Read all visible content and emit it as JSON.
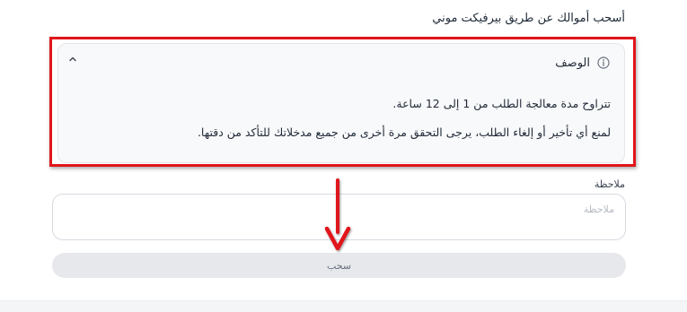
{
  "heading": "أسحب أموالك عن طريق بيرفيكت موني",
  "description_card": {
    "title": "الوصف",
    "line1": "تتراوح مدة معالجة الطلب من 1 إلى 12 ساعة.",
    "line2": "لمنع أي تأخير أو إلغاء الطلب، يرجى التحقق مرة أخرى من جميع مدخلاتك للتأكد من دقتها.",
    "info_icon": "info-icon",
    "collapse_icon": "chevron-up-icon"
  },
  "note": {
    "label": "ملاحظة",
    "placeholder": "ملاحظة",
    "value": ""
  },
  "submit_button": {
    "label": "سحب"
  },
  "colors": {
    "annotation_red": "#e0161b",
    "card_bg": "#f8f9fa",
    "button_bg": "#e6e8eb"
  }
}
